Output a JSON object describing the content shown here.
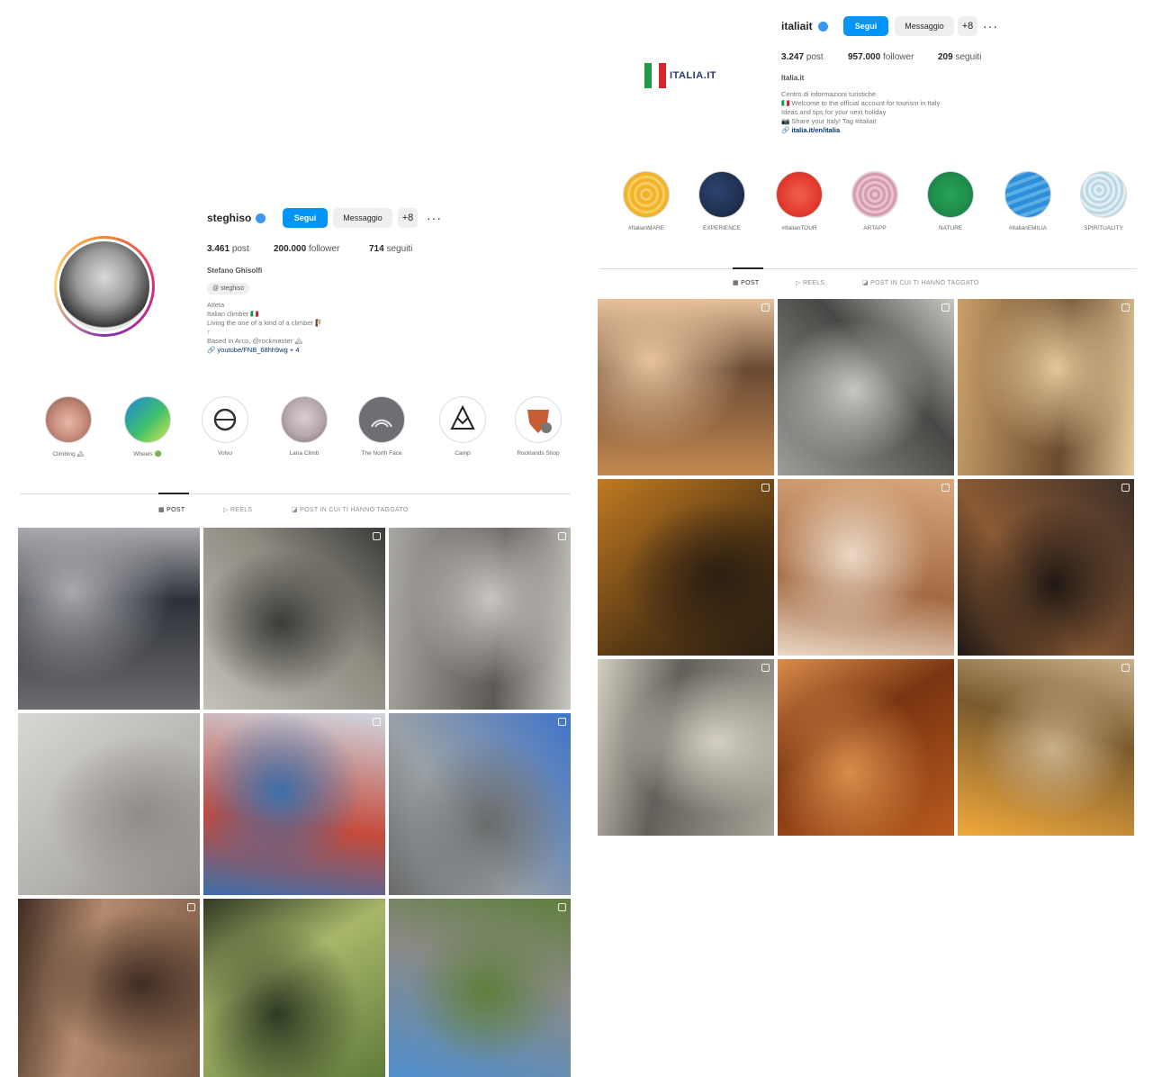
{
  "profiles": [
    {
      "username": "steghiso",
      "follow_label": "Segui",
      "message_label": "Messaggio",
      "add_label": "+8",
      "more_label": "···",
      "stats": {
        "posts": "3.461",
        "posts_label": "post",
        "followers": "200.000",
        "followers_label": "follower",
        "following": "714",
        "following_label": "seguiti"
      },
      "bio": {
        "name": "Stefano Ghisolfi",
        "thread": "steghiso",
        "lines": [
          "Atleta",
          "Italian climber 🇮🇹",
          "Living the one of a kind of a climber 🧗",
          "↑",
          "Based in Arco, @rockmaster 🏔",
          "🔗 youtube/FNB_68hh9wg + 4"
        ]
      },
      "highlights": [
        {
          "label": "Climbing 🏔",
          "icon": "hands-photo",
          "color": "#c98e7e"
        },
        {
          "label": "Wheels 🟢",
          "icon": "globe-graphic",
          "color": "#1f88d6"
        },
        {
          "label": "Volvo",
          "icon": "volvo-logo",
          "color": "#ffffff"
        },
        {
          "label": "Lana Climb",
          "icon": "people-photo",
          "color": "#b7a6ad"
        },
        {
          "label": "The North Face",
          "icon": "tnf-logo",
          "color": "#6d6f75"
        },
        {
          "label": "Camp",
          "icon": "camp-logo",
          "color": "#ffffff"
        },
        {
          "label": "Rocklands Shop",
          "icon": "shield-logo",
          "color": "#c85c34"
        }
      ],
      "tabs": [
        {
          "label": "POST",
          "icon": "grid-icon",
          "active": true
        },
        {
          "label": "REELS",
          "icon": "reels-icon",
          "active": false
        },
        {
          "label": "POST IN CUI TI HANNO TAGGATO",
          "icon": "tag-icon",
          "active": false
        }
      ],
      "posts": [
        {
          "subject": "climber in blue under roof",
          "colors": [
            "#6b6c70",
            "#2e3138",
            "#a9aab0"
          ],
          "multi": false
        },
        {
          "subject": "climber in red on overhang",
          "colors": [
            "#c4c1b8",
            "#8d8a80",
            "#3b3b38"
          ],
          "multi": true
        },
        {
          "subject": "shirtless climber in cave",
          "colors": [
            "#a9a7a2",
            "#5d5a55",
            "#c9c6c1"
          ],
          "multi": true
        },
        {
          "subject": "climber hanging on rope over city",
          "colors": [
            "#d9d7d2",
            "#b4b2ad",
            "#8f8c87"
          ],
          "multi": false
        },
        {
          "subject": "two men at climbing gym",
          "colors": [
            "#cfd6df",
            "#c44a3b",
            "#3d6fa9"
          ],
          "multi": true
        },
        {
          "subject": "climber on cliff blue sky",
          "colors": [
            "#3f74c9",
            "#9aa1a6",
            "#6a6b6b"
          ],
          "multi": true
        },
        {
          "subject": "hand on rock hold",
          "colors": [
            "#7b5a45",
            "#b58b6e",
            "#3f2d22"
          ],
          "multi": true
        },
        {
          "subject": "man on e-bike in forest",
          "colors": [
            "#5f7a3a",
            "#a8b76a",
            "#2f3a24"
          ],
          "multi": false
        },
        {
          "subject": "climber on roof over valley",
          "colors": [
            "#4f8fd0",
            "#8a8a84",
            "#5f7f3c"
          ],
          "multi": true
        }
      ]
    },
    {
      "username": "italiait",
      "follow_label": "Segui",
      "message_label": "Messaggio",
      "add_label": "+8",
      "more_label": "···",
      "logo_text": "ITALIA.IT",
      "stats": {
        "posts": "3.247",
        "posts_label": "post",
        "followers": "957.000",
        "followers_label": "follower",
        "following": "209",
        "following_label": "seguiti"
      },
      "bio": {
        "name": "Italia.it",
        "lines": [
          "Centro di informazioni turistiche",
          "🇮🇹 Welcome to the official account for tourism in Italy",
          "Ideas and tips for your next holiday",
          "📷 Share your Italy! Tag #italiait",
          "🔗 italia.it/en/italia"
        ]
      },
      "highlights": [
        {
          "label": "#ItalianMARE",
          "icon": "yellow-pattern",
          "color": "#f2b32a"
        },
        {
          "label": "EXPERIENCE",
          "icon": "navy-pattern",
          "color": "#1f3150"
        },
        {
          "label": "#ItalianTOUR",
          "icon": "red-pattern",
          "color": "#e23b2e"
        },
        {
          "label": "ARTAPP",
          "icon": "pink-pattern",
          "color": "#e7c3cf"
        },
        {
          "label": "NATURE",
          "icon": "green-pattern",
          "color": "#1e8c4a"
        },
        {
          "label": "#ItalianEMILIA",
          "icon": "blue-pattern",
          "color": "#2f8ed8"
        },
        {
          "label": "SPIRITUALITY",
          "icon": "lightblue-pattern",
          "color": "#b8d8e6"
        }
      ],
      "tabs": [
        {
          "label": "POST",
          "icon": "grid-icon",
          "active": true
        },
        {
          "label": "REELS",
          "icon": "reels-icon",
          "active": false
        },
        {
          "label": "POST IN CUI TI HANNO TAGGATO",
          "icon": "tag-icon",
          "active": false
        }
      ],
      "posts": [
        {
          "subject": "hill town at sunset",
          "colors": [
            "#c28850",
            "#6a4a33",
            "#e7c29c"
          ],
          "multi": true
        },
        {
          "subject": "stone monster mouth",
          "colors": [
            "#9e9c97",
            "#4a4846",
            "#c8c6c1"
          ],
          "multi": true
        },
        {
          "subject": "pasta close-up",
          "colors": [
            "#c9a06a",
            "#6b4a2d",
            "#e4c89a"
          ],
          "multi": true
        },
        {
          "subject": "autumn lake with swans",
          "colors": [
            "#c07a22",
            "#5a3a14",
            "#2b1e12"
          ],
          "multi": true
        },
        {
          "subject": "eroded rock formation",
          "colors": [
            "#d8a77b",
            "#a46a43",
            "#ead8c5"
          ],
          "multi": true
        },
        {
          "subject": "night village with lights",
          "colors": [
            "#3e2f27",
            "#8a5a34",
            "#1f1814"
          ],
          "multi": true
        },
        {
          "subject": "gothic cathedral and mountains",
          "colors": [
            "#a8a398",
            "#62605a",
            "#d4cfc2"
          ],
          "multi": true
        },
        {
          "subject": "winding road in autumn hills",
          "colors": [
            "#b85a1e",
            "#7a3411",
            "#d88d4b"
          ],
          "multi": false
        },
        {
          "subject": "palace facade at sunset",
          "colors": [
            "#f0a93c",
            "#7a5a2e",
            "#c9b08a"
          ],
          "multi": true
        }
      ]
    }
  ]
}
